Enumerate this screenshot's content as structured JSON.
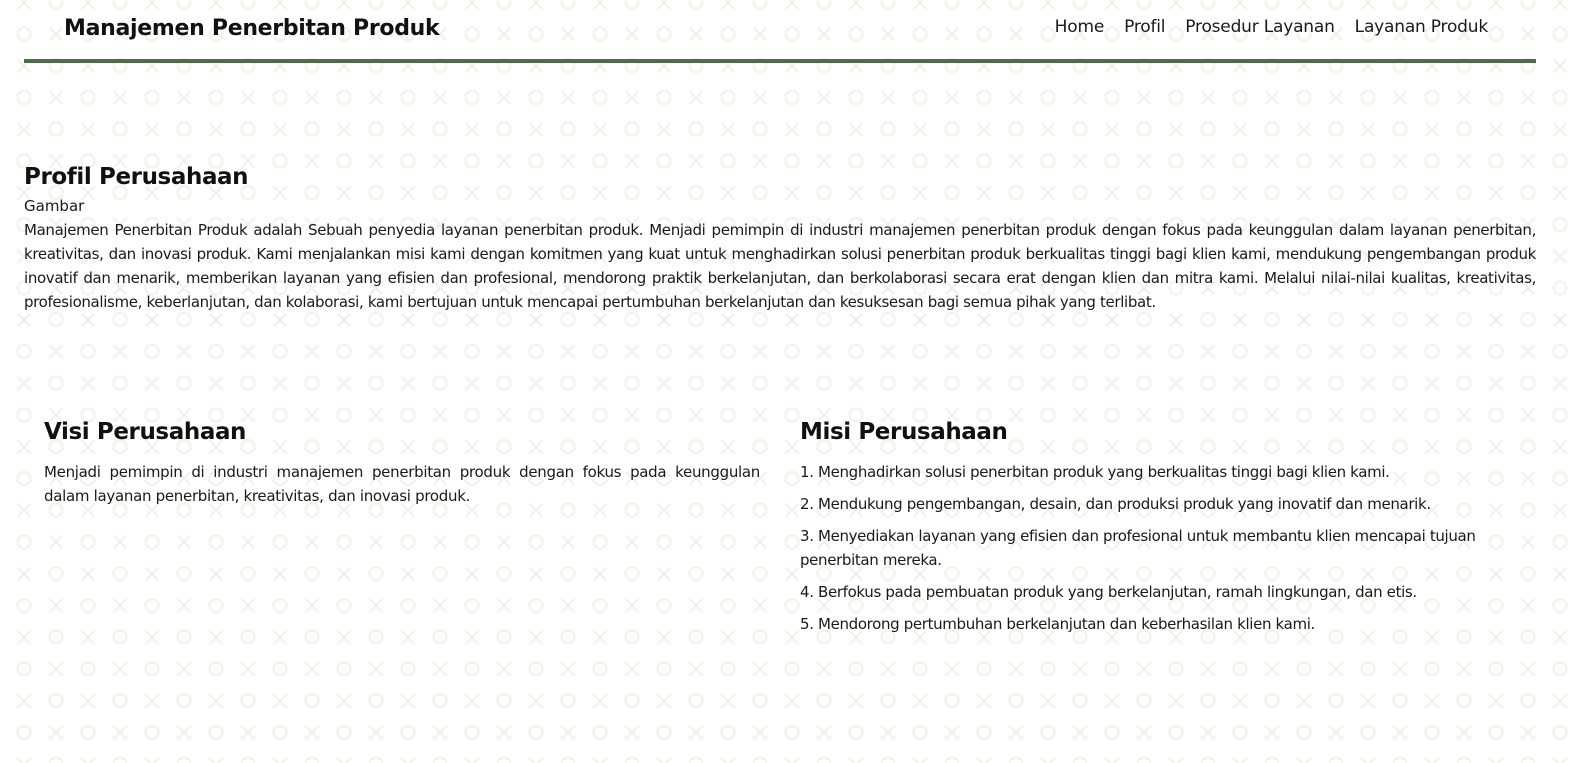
{
  "colors": {
    "accent": "#4f6b49",
    "pattern": "#f1f3e6",
    "text": "#1a1a1a"
  },
  "header": {
    "brand": "Manajemen Penerbitan Produk",
    "nav": [
      "Home",
      "Profil",
      "Prosedur Layanan",
      "Layanan Produk"
    ]
  },
  "profil": {
    "title": "Profil Perusahaan",
    "image_label": "Gambar",
    "text": "Manajemen Penerbitan Produk adalah Sebuah penyedia layanan penerbitan produk. Menjadi pemimpin di industri manajemen penerbitan produk dengan fokus pada keunggulan dalam layanan penerbitan, kreativitas, dan inovasi produk. Kami menjalankan misi kami dengan komitmen yang kuat untuk menghadirkan solusi penerbitan produk berkualitas tinggi bagi klien kami, mendukung pengembangan produk inovatif dan menarik, memberikan layanan yang efisien dan profesional, mendorong praktik berkelanjutan, dan berkolaborasi secara erat dengan klien dan mitra kami. Melalui nilai-nilai kualitas, kreativitas, profesionalisme, keberlanjutan, dan kolaborasi, kami bertujuan untuk mencapai pertumbuhan berkelanjutan dan kesuksesan bagi semua pihak yang terlibat."
  },
  "visi": {
    "title": "Visi Perusahaan",
    "text": "Menjadi pemimpin di industri manajemen penerbitan produk dengan fokus pada keunggulan dalam layanan penerbitan, kreativitas, dan inovasi produk."
  },
  "misi": {
    "title": "Misi Perusahaan",
    "items": [
      "1. Menghadirkan solusi penerbitan produk yang berkualitas tinggi bagi klien kami.",
      "2. Mendukung pengembangan, desain, dan produksi produk yang inovatif dan menarik.",
      "3. Menyediakan layanan yang efisien dan profesional untuk membantu klien mencapai tujuan penerbitan mereka.",
      "4. Berfokus pada pembuatan produk yang berkelanjutan, ramah lingkungan, dan etis.",
      "5. Mendorong pertumbuhan berkelanjutan dan keberhasilan klien kami."
    ]
  }
}
